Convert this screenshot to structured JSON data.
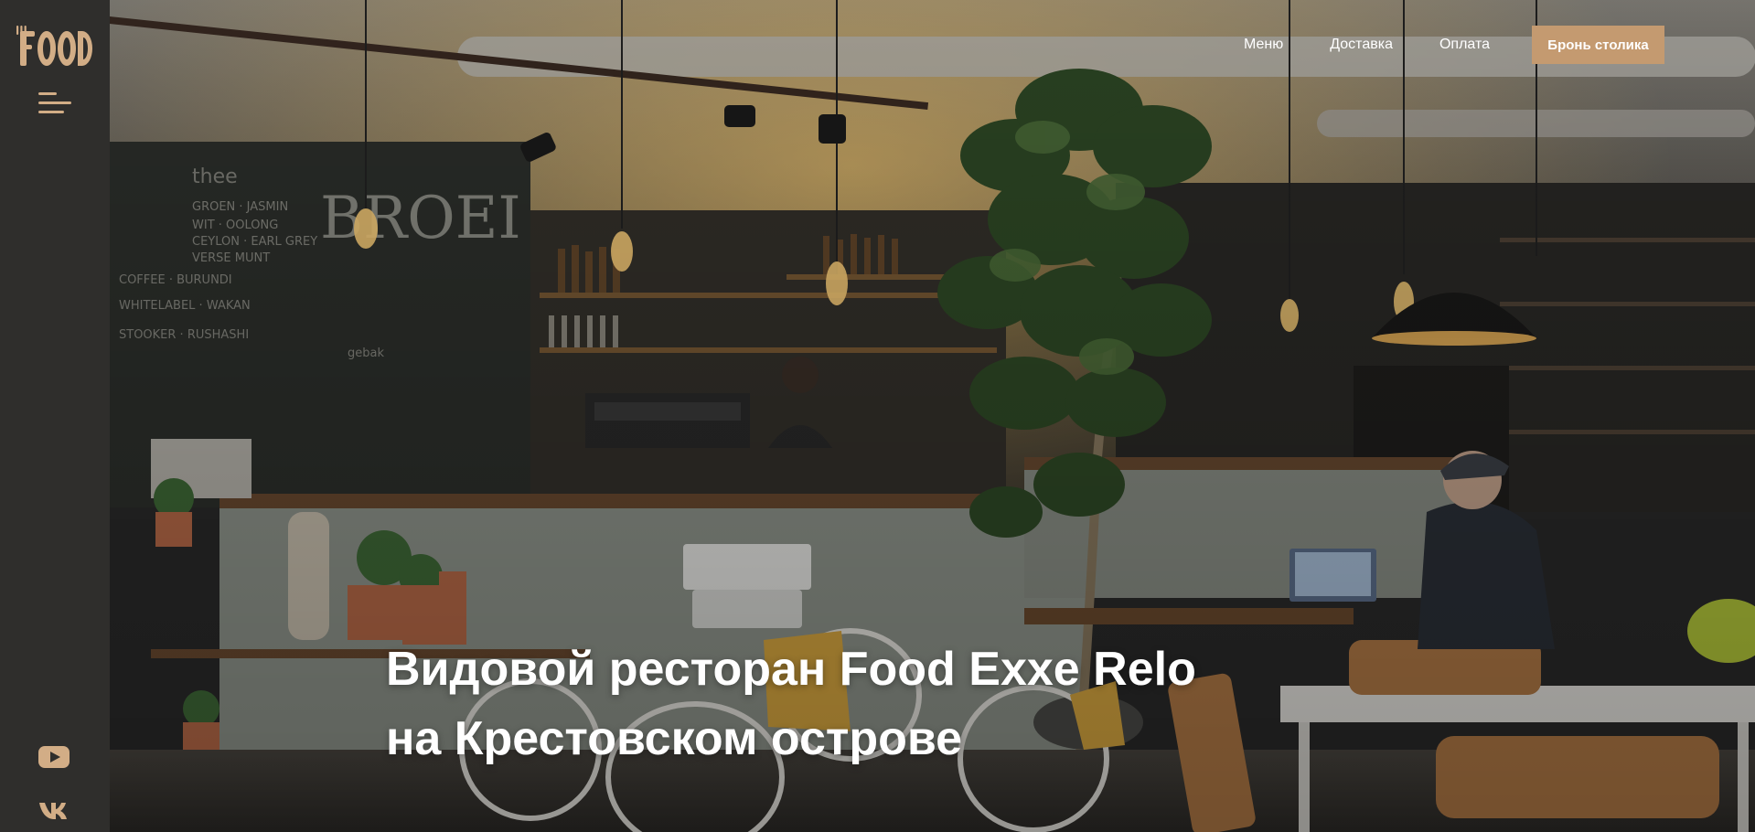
{
  "brand": {
    "logo_text": "FOOD",
    "accent_color": "#c49a70",
    "sidebar_color": "#2f2e2c"
  },
  "sidebar": {
    "menu_icon": "hamburger-menu-icon",
    "social": [
      {
        "icon": "youtube-icon"
      },
      {
        "icon": "vk-icon"
      }
    ]
  },
  "nav": {
    "items": [
      {
        "label": "Меню"
      },
      {
        "label": "Доставка"
      },
      {
        "label": "Оплата"
      }
    ],
    "cta_label": "Бронь столика"
  },
  "hero": {
    "title_line1": "Видовой ресторан Food Exxe Relo",
    "title_line2": "на Крестовском острове"
  }
}
